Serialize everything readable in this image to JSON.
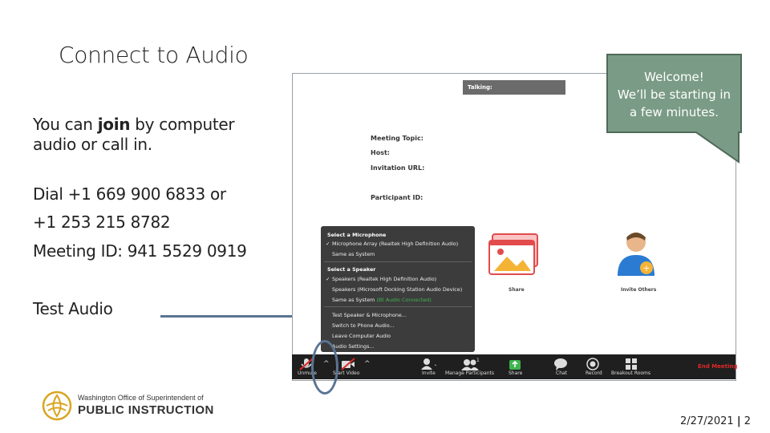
{
  "slide": {
    "title": "Connect to Audio",
    "join_pre": "You can ",
    "join_bold": "join",
    "join_post": " by computer",
    "join_line2": "audio or call in.",
    "dial_line1": "Dial +1 669 900 6833 or",
    "dial_line2": "+1 253 215 8782",
    "meeting_id": "Meeting ID: 941 5529 0919",
    "test_audio": "Test Audio",
    "footer_line1": "Washington Office of Superintendent of",
    "footer_line2": "PUBLIC INSTRUCTION",
    "footer_date": "2/27/2021",
    "footer_sep": "|",
    "footer_page": "2"
  },
  "callout": {
    "line1": "Welcome!",
    "line2": "We’ll be starting in",
    "line3": "a few minutes."
  },
  "zoom": {
    "talking": "Talking:",
    "info": [
      "Meeting Topic:",
      "Host:",
      "Invitation URL:",
      "Participant ID:"
    ],
    "share_label": "Share",
    "invite_label": "Invite Others",
    "menu": {
      "mic_header": "Select a Microphone",
      "mic_items": [
        "Microphone Array (Realtek High Definition Audio)",
        "Same as System"
      ],
      "speaker_header": "Select a Speaker",
      "speaker_items": [
        "Speakers (Realtek High Definition Audio)",
        "Speakers (Microsoft Docking Station Audio Device)",
        "Same as System"
      ],
      "speaker_status": "(Bt Audio Connected)",
      "check": "✓",
      "actions": [
        "Test Speaker & Microphone...",
        "Switch to Phone Audio...",
        "Leave Computer Audio",
        "Audio Settings..."
      ]
    },
    "toolbar": {
      "unmute": "Unmute",
      "start_video": "Start Video",
      "invite": "Invite",
      "manage": "Manage Participants",
      "participant_count": "1",
      "share": "Share",
      "chat": "Chat",
      "record": "Record",
      "breakout": "Breakout Rooms",
      "end": "End Meeting",
      "caret": "^"
    }
  },
  "colors": {
    "arrow": "#5b7493",
    "callout_fill": "#7a9b85",
    "end_meeting": "#e02828",
    "logo_gold": "#d9a520"
  }
}
